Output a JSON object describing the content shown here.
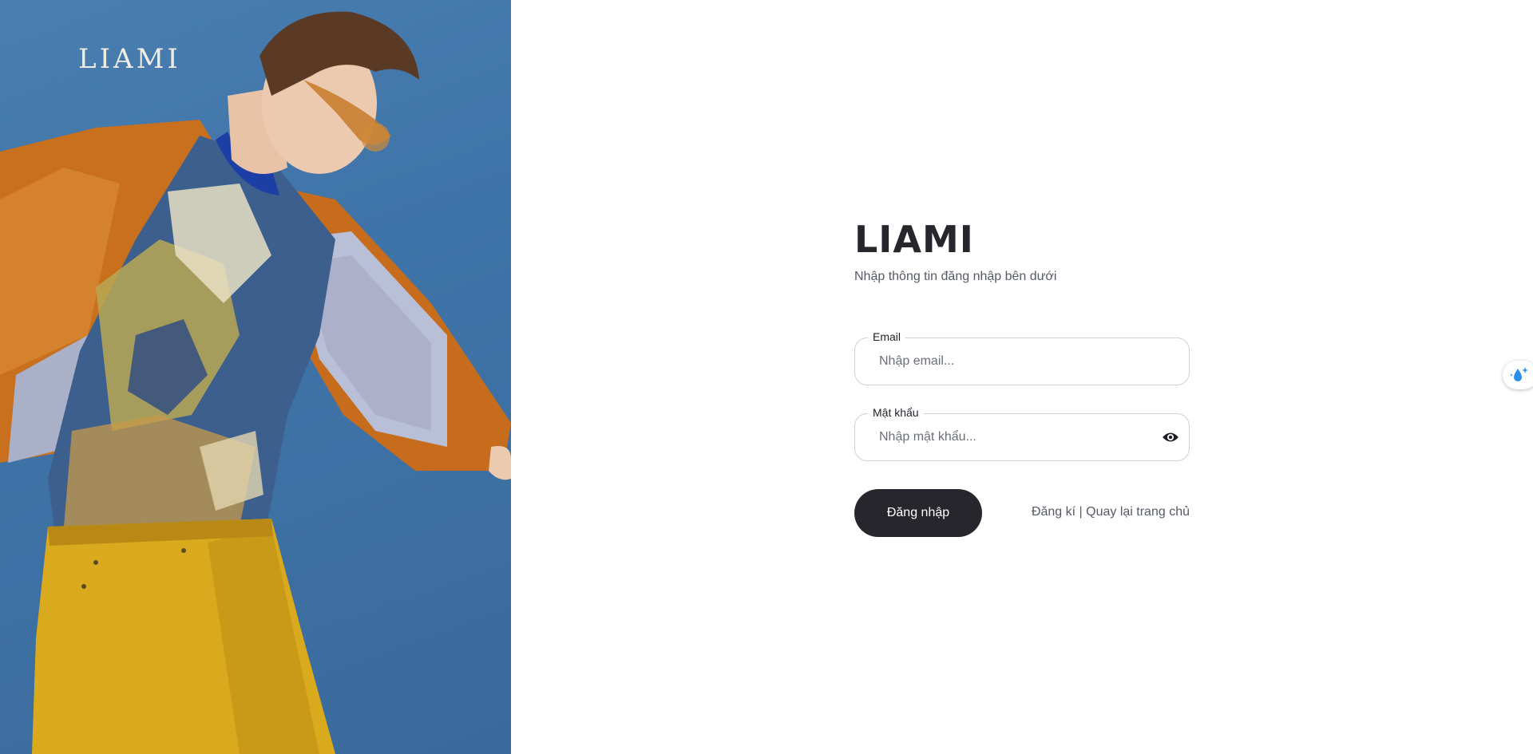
{
  "hero": {
    "logo": "LIAMI"
  },
  "login": {
    "title": "LIAMI",
    "subtitle": "Nhập thông tin đăng nhập bên dưới",
    "email": {
      "label": "Email",
      "placeholder": "Nhập email...",
      "value": ""
    },
    "password": {
      "label": "Mật khẩu",
      "placeholder": "Nhập mật khẩu...",
      "value": "",
      "toggle_icon": "eye-icon"
    },
    "submit_label": "Đăng nhập",
    "register_link": "Đăng kí",
    "separator": " | ",
    "home_link": "Quay lại trang chủ"
  },
  "widget": {
    "icon": "sparkle-drop-icon",
    "accent": "#2a8fe6"
  },
  "colors": {
    "hero_background": "#3f74a8",
    "primary_button": "#26262c"
  }
}
